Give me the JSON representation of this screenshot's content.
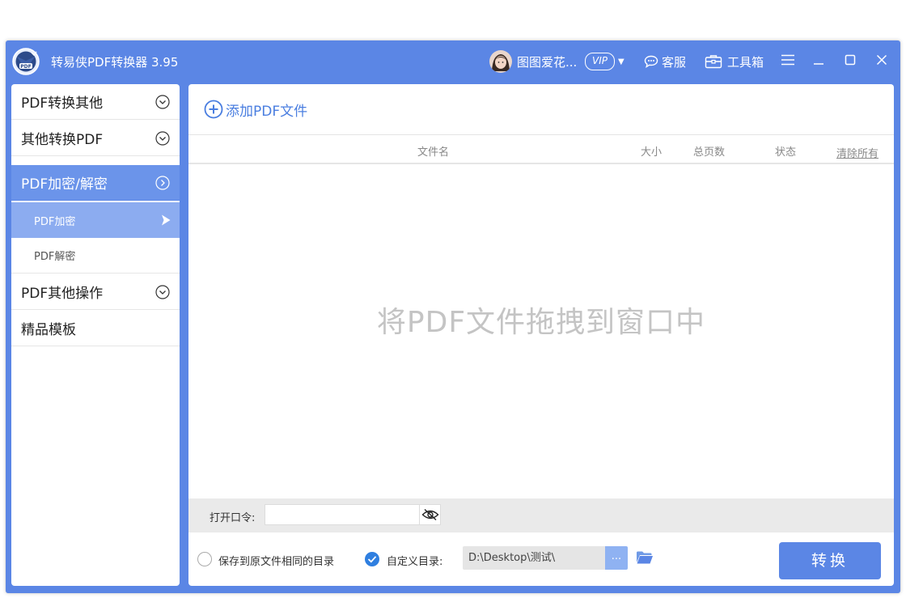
{
  "app": {
    "title": "转易侠PDF转换器 3.95",
    "logo_text": "PDF"
  },
  "titlebar": {
    "user_name": "图图爱花...",
    "vip_label": "VIP",
    "service_label": "客服",
    "toolbox_label": "工具箱"
  },
  "sidebar": {
    "items": [
      {
        "label": "PDF转换其他"
      },
      {
        "label": "其他转换PDF"
      },
      {
        "label": "PDF加密/解密"
      },
      {
        "label": "PDF其他操作"
      },
      {
        "label": "精品模板"
      }
    ],
    "sub_items": [
      {
        "label": "PDF加密"
      },
      {
        "label": "PDF解密"
      }
    ]
  },
  "main": {
    "add_file_label": "添加PDF文件",
    "columns": {
      "filename": "文件名",
      "size": "大小",
      "pages": "总页数",
      "status": "状态",
      "clear_all": "清除所有"
    },
    "drop_hint": "将PDF文件拖拽到窗口中",
    "password_label": "打开口令:",
    "password_value": "",
    "save_same_dir_label": "保存到原文件相同的目录",
    "custom_dir_label": "自定义目录:",
    "custom_dir_value": "D:\\Desktop\\测试\\",
    "browse_label": "...",
    "convert_label": "转换"
  },
  "colors": {
    "accent": "#5b86e5",
    "sidebar_active": "#6b94ea",
    "sub_active": "#8cacf0",
    "link_blue": "#4a7ee0"
  },
  "icons": [
    "app-logo-icon",
    "user-avatar-icon",
    "chevron-down-icon",
    "chat-icon",
    "toolbox-icon",
    "menu-icon",
    "minimize-icon",
    "maximize-icon",
    "close-icon",
    "circle-chevron-icon",
    "arrow-right-icon",
    "plus-circle-icon",
    "eye-slash-icon",
    "check-icon",
    "folder-icon"
  ]
}
